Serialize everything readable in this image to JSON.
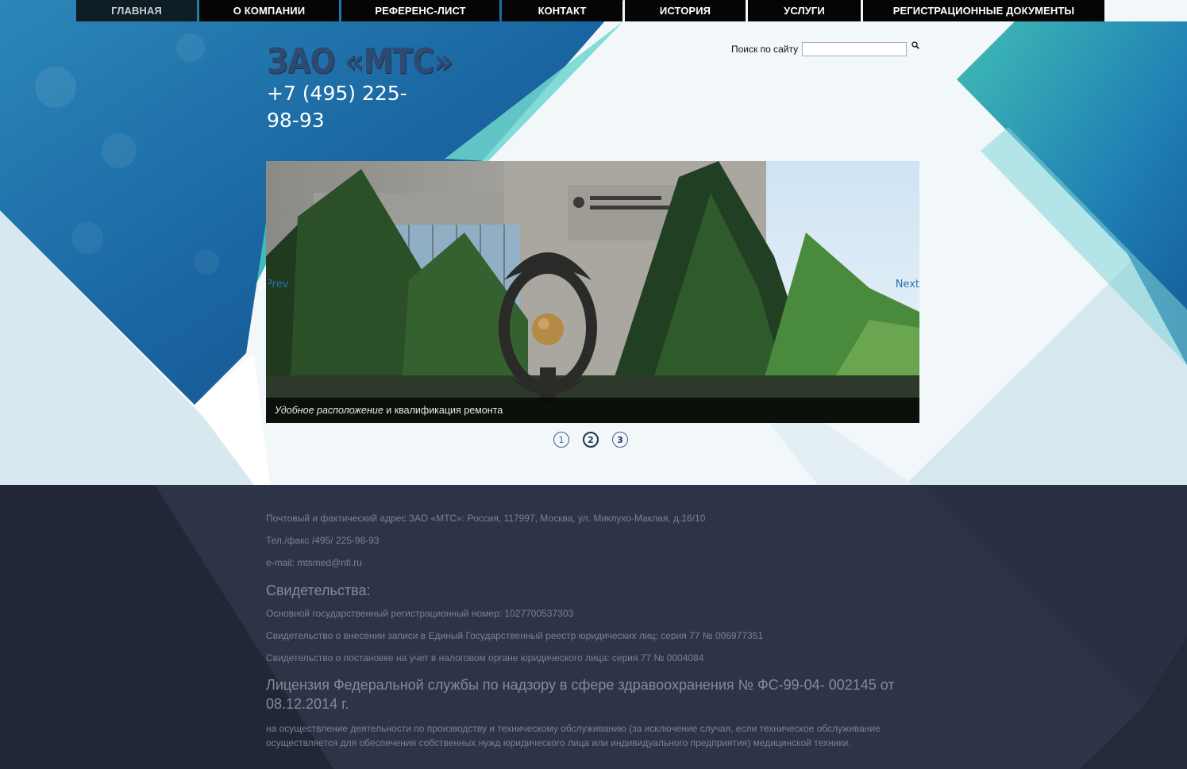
{
  "nav": {
    "items": [
      {
        "label": "ГЛАВНАЯ"
      },
      {
        "label": "О КОМПАНИИ"
      },
      {
        "label": "РЕФЕРЕНС-ЛИСТ"
      },
      {
        "label": "КОНТАКТ"
      },
      {
        "label": "ИСТОРИЯ"
      },
      {
        "label": "УСЛУГИ"
      },
      {
        "label": "РЕГИСТРАЦИОННЫЕ ДОКУМЕНТЫ"
      }
    ],
    "active_index": 0
  },
  "header": {
    "logo_text": "ЗАО «МТС»",
    "phone": "+7 (495) 225-98-93"
  },
  "search": {
    "label": "Поиск по сайту",
    "value": "",
    "icon": "search-icon"
  },
  "slider": {
    "prev_label": "Prev",
    "next_label": "Next",
    "caption_italic": "Удобное расположение",
    "caption_rest": " и квалификация ремонта",
    "pages": [
      "1",
      "2",
      "3"
    ],
    "active_page": 2
  },
  "footer": {
    "address": "Почтовый и фактический адрес ЗАО «МТС»: Россия, 117997, Москва, ул. Миклухо-Маклая, д.16/10",
    "phone": "Тел./факс /495/ 225-98-93",
    "email": "e-mail: mtsmed@ntl.ru",
    "certs_heading": "Свидетельства:",
    "ogrn": "Основной государственный регистрационный номер: 1027700537303",
    "egrul": "Свидетельство о внесении записи в Единый Государственный реестр юридических лиц: серия 77 № 006977351",
    "tax": "Свидетельство о постановке на учет в налоговом органе юридического лица: серия 77 № 0004084",
    "license_heading": "Лицензия Федеральной службы по надзору в сфере здравоохранения № ФС-99-04- 002145 от 08.12.2014 г.",
    "license_text": "на осуществление деятельности по производству и техническому обслуживанию (за исключение случая, если техническое обслуживание осуществляется для обеспечения собственных нужд юридического лица или индивидуального предприятия) медицинской техники."
  },
  "colors": {
    "nav_bg": "#050505",
    "hero_blue": "#1e6aa6",
    "hero_teal": "#3fb8b6",
    "footer_bg": "#252a3a",
    "link_blue": "#2c6fb2"
  }
}
